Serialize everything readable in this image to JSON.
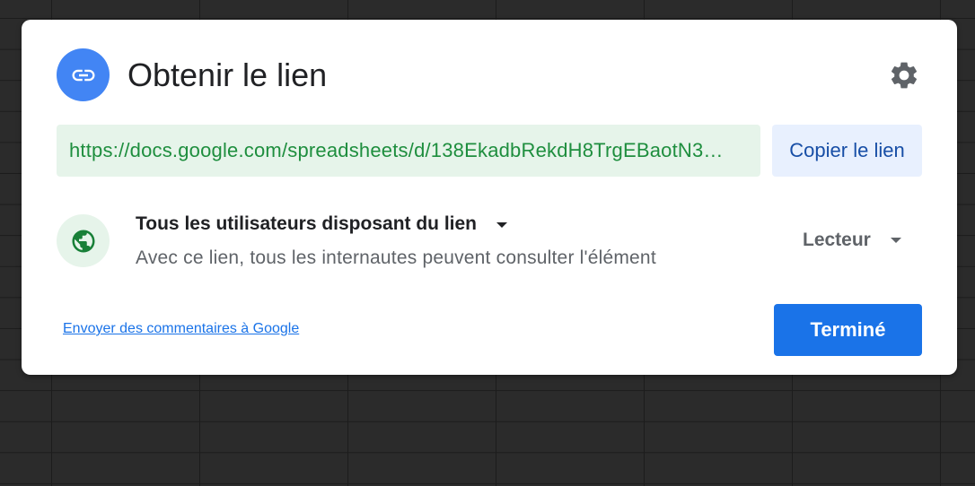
{
  "dialog": {
    "title": "Obtenir le lien",
    "header_icon": "link-icon",
    "settings_icon": "gear-icon"
  },
  "link": {
    "url": "https://docs.google.com/spreadsheets/d/138EkadbRekdH8TrgEBaotN3…",
    "copy_label": "Copier le lien"
  },
  "access": {
    "icon": "globe-icon",
    "scope_label": "Tous les utilisateurs disposant du lien",
    "description": "Avec ce lien, tous les internautes peuvent consulter l'élément",
    "role_label": "Lecteur"
  },
  "footer": {
    "feedback_label": "Envoyer des commentaires à Google",
    "done_label": "Terminé"
  },
  "colors": {
    "accent_blue": "#1a73e8",
    "link_icon_bg": "#4285f4",
    "link_field_bg": "#e6f4ea",
    "link_text": "#1e8e3e",
    "copy_button_bg": "#e8f0fe",
    "globe_green": "#188038"
  }
}
